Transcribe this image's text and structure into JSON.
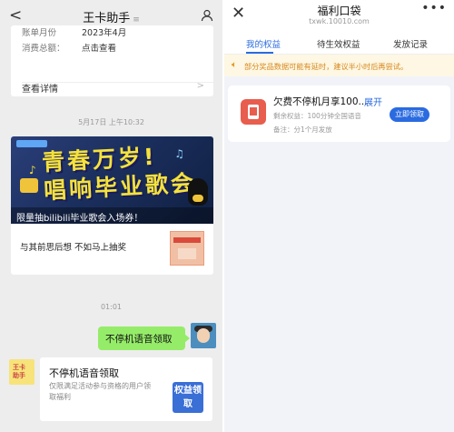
{
  "chat": {
    "header": {
      "back": "<",
      "title": "王卡助手",
      "subtitle": "≡"
    },
    "bill_card": {
      "row1_label": "账单月份",
      "row1_value": "2023年4月",
      "row2_label": "消费总额：",
      "row2_value": "点击查看",
      "detail": "查看详情",
      "chevron": ">"
    },
    "timestamp1": "5月17日 上午10:32",
    "banner_card": {
      "headline1": "青春万岁!",
      "headline2": "唱响毕业歌会",
      "caption": "限量抽bilibili毕业歌会入场券！",
      "text": "与其前思后想 不如马上抽奖"
    },
    "timestamp2": "01:01",
    "my_message": "不停机语音领取",
    "bot_avatar_text": "王卡\n助手",
    "bot_card": {
      "title": "不停机语音领取",
      "desc": "仅限满足活动参与资格的用户领取福利",
      "badge": "权益领取"
    }
  },
  "pocket": {
    "header": {
      "close": "✕",
      "title": "福利口袋",
      "url": "txwk.10010.com",
      "more": "•••"
    },
    "tabs": [
      {
        "label": "我的权益",
        "active": true
      },
      {
        "label": "待生效权益",
        "active": false
      },
      {
        "label": "发放记录",
        "active": false
      }
    ],
    "notice": {
      "icon": "speaker-icon",
      "text": "部分奖品数据可能有延时，建议半小时后再尝试。"
    },
    "benefit": {
      "title": "欠费不停机月享100...",
      "expand": "展开",
      "remaining": "剩余权益：100分钟全国语音",
      "note": "备注：分1个月发放",
      "button": "立即领取"
    }
  },
  "colors": {
    "accent": "#2b6be0",
    "chat_bubble": "#95ec69",
    "notice": "#d8891f"
  }
}
